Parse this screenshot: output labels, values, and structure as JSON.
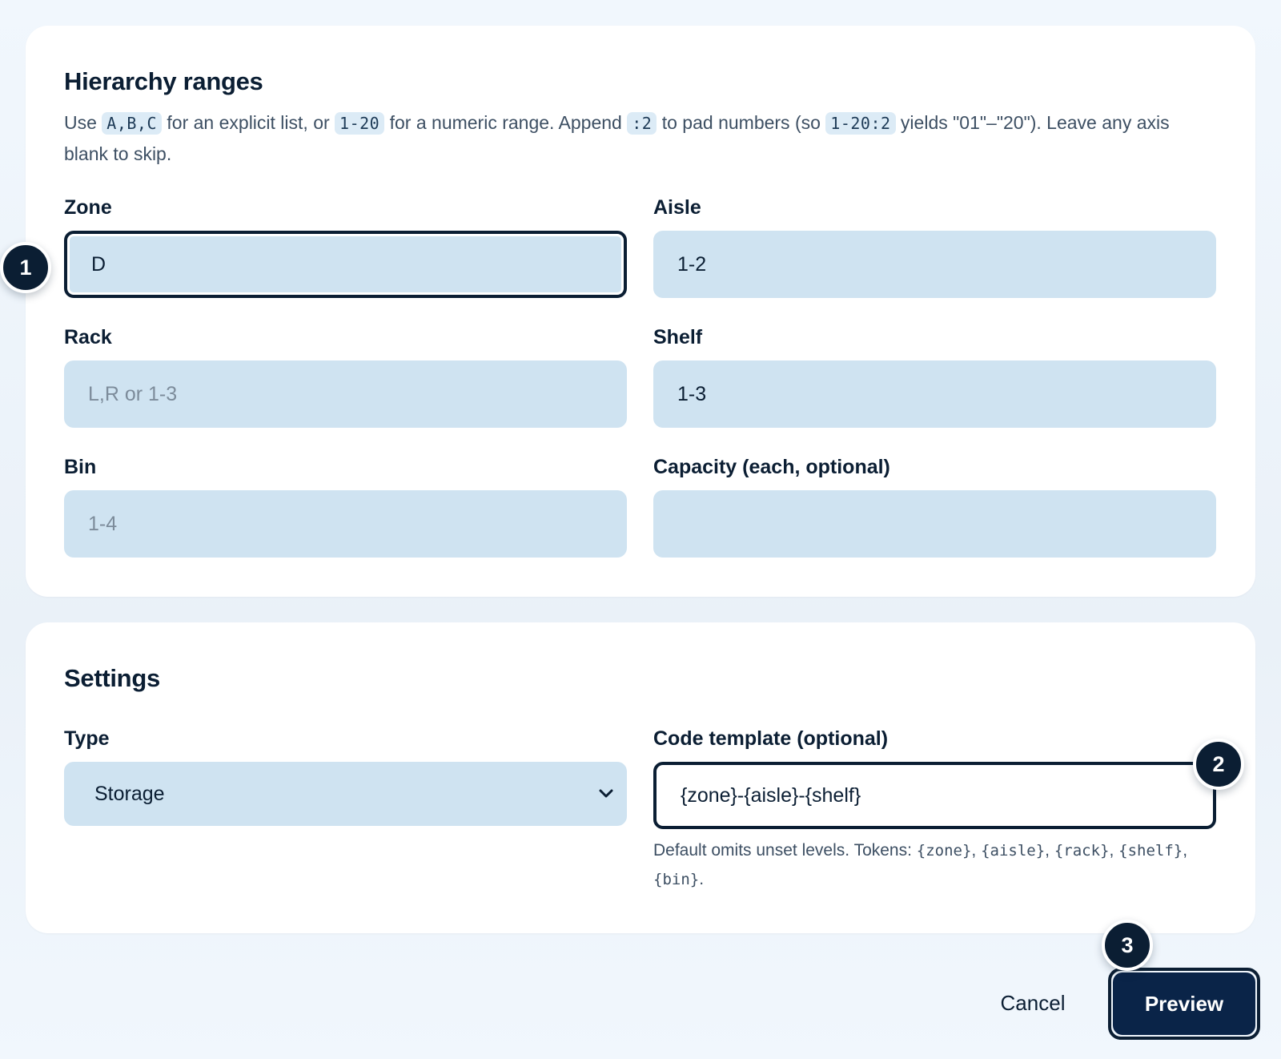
{
  "ranges": {
    "title": "Hierarchy ranges",
    "desc": {
      "t1": "Use ",
      "c1": "A,B,C",
      "t2": " for an explicit list, or ",
      "c2": "1-20",
      "t3": " for a numeric range. Append ",
      "c3": ":2",
      "t4": " to pad numbers (so ",
      "c4": "1-20:2",
      "t5": " yields \"01\"–\"20\"). Leave any axis blank to skip."
    },
    "zone": {
      "label": "Zone",
      "value": "D",
      "placeholder": ""
    },
    "aisle": {
      "label": "Aisle",
      "value": "1-2",
      "placeholder": ""
    },
    "rack": {
      "label": "Rack",
      "value": "",
      "placeholder": "L,R or 1-3"
    },
    "shelf": {
      "label": "Shelf",
      "value": "1-3",
      "placeholder": ""
    },
    "bin": {
      "label": "Bin",
      "value": "",
      "placeholder": "1-4"
    },
    "capacity": {
      "label": "Capacity (each, optional)",
      "value": "",
      "placeholder": ""
    }
  },
  "settings": {
    "title": "Settings",
    "type": {
      "label": "Type",
      "selected": "Storage",
      "icon": "chevron-down-icon"
    },
    "template": {
      "label": "Code template (optional)",
      "value": "{zone}-{aisle}-{shelf}",
      "help": {
        "t1": "Default omits unset levels. Tokens: ",
        "k1": "{zone}",
        "s1": ", ",
        "k2": "{aisle}",
        "s2": ", ",
        "k3": "{rack}",
        "s3": ", ",
        "k4": "{shelf}",
        "s4": ", ",
        "k5": "{bin}",
        "t2": "."
      }
    }
  },
  "actions": {
    "cancel": "Cancel",
    "preview": "Preview"
  },
  "badges": {
    "one": "1",
    "two": "2",
    "three": "3"
  },
  "colors": {
    "accent": "#0b1e33",
    "input_bg": "#cfe3f1",
    "primary_button": "#0a2448"
  }
}
